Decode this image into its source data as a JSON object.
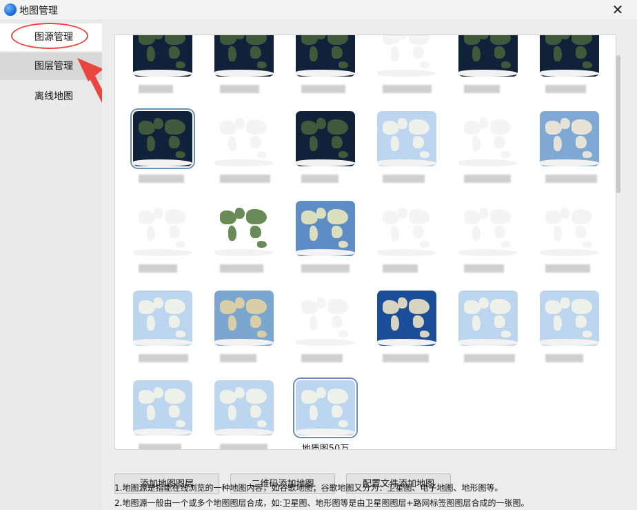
{
  "window": {
    "title": "地图管理",
    "close_glyph": "✕"
  },
  "sidebar": {
    "items": [
      {
        "label": "图源管理",
        "active": true
      },
      {
        "label": "图层管理",
        "active": false
      },
      {
        "label": "离线地图",
        "active": false
      }
    ]
  },
  "grid": {
    "tiles": [
      {
        "style": "dark",
        "caption": ""
      },
      {
        "style": "dark",
        "caption": ""
      },
      {
        "style": "dark",
        "caption": ""
      },
      {
        "style": "white",
        "caption": ""
      },
      {
        "style": "dark",
        "caption": ""
      },
      {
        "style": "dark",
        "caption": ""
      },
      {
        "style": "dark",
        "caption": "",
        "selected": true
      },
      {
        "style": "white",
        "caption": ""
      },
      {
        "style": "dark",
        "caption": ""
      },
      {
        "style": "light-blue",
        "caption": ""
      },
      {
        "style": "white",
        "caption": ""
      },
      {
        "style": "terrain-blue",
        "caption": ""
      },
      {
        "style": "white",
        "caption": ""
      },
      {
        "style": "green",
        "caption": ""
      },
      {
        "style": "blue",
        "caption": ""
      },
      {
        "style": "white",
        "caption": ""
      },
      {
        "style": "white",
        "caption": ""
      },
      {
        "style": "white",
        "caption": ""
      },
      {
        "style": "light-blue",
        "caption": ""
      },
      {
        "style": "terrain",
        "caption": ""
      },
      {
        "style": "white",
        "caption": ""
      },
      {
        "style": "deep-blue",
        "caption": ""
      },
      {
        "style": "light-blue",
        "caption": ""
      },
      {
        "style": "light-blue",
        "caption": ""
      },
      {
        "style": "light-blue",
        "caption": ""
      },
      {
        "style": "light-blue",
        "caption": ""
      },
      {
        "style": "light-blue",
        "caption": "地质图50万",
        "selected": true
      }
    ]
  },
  "buttons": {
    "add_layer": "添加地图图层",
    "qr_add": "二维码添加地图",
    "config_add": "配置文件添加地图"
  },
  "notes": [
    "1.地图源是指能在线浏览的一种地图内容，如谷歌地图；谷歌地图又分为：卫星图、电子地图、地形图等。",
    "2.地图源一般由一个或多个地图图层合成，如:卫星图、地形图等是由卫星图图层+路网标签图图层合成的一张图。"
  ],
  "colors": {
    "accent_red": "#e9463f",
    "selection_blue": "#6a8fb6"
  }
}
